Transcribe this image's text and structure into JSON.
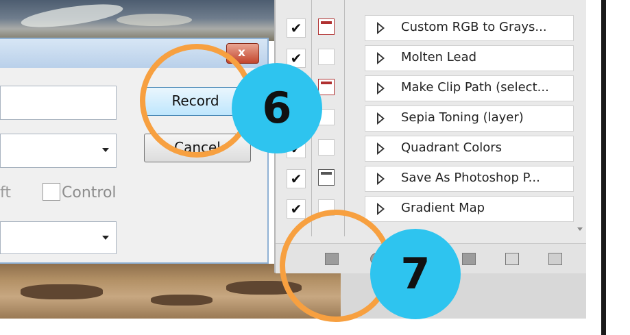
{
  "dialog": {
    "name_value": "",
    "set_value": "",
    "shift_fragment": "ft",
    "control_label": "Control",
    "color_value": "",
    "record_label": "Record",
    "cancel_label": "Cancel",
    "close_glyph": "x"
  },
  "actions_panel": {
    "items": [
      {
        "label": "Custom RGB to Grays...",
        "checked": true,
        "dialog": "on"
      },
      {
        "label": "Molten Lead",
        "checked": true,
        "dialog": "off"
      },
      {
        "label": "Make Clip Path (select...",
        "checked": true,
        "dialog": "on"
      },
      {
        "label": "Sepia Toning (layer)",
        "checked": true,
        "dialog": "off"
      },
      {
        "label": "Quadrant Colors",
        "checked": true,
        "dialog": "off"
      },
      {
        "label": "Save As Photoshop P...",
        "checked": true,
        "dialog": "dark"
      },
      {
        "label": "Gradient Map",
        "checked": true,
        "dialog": "off"
      }
    ],
    "check_glyph": "✔",
    "toolbar_icons": [
      "stop-icon",
      "record-icon",
      "play-icon",
      "folder-icon",
      "new-action-icon",
      "trash-icon"
    ]
  },
  "annotations": {
    "step6": "6",
    "step7": "7"
  },
  "colors": {
    "ring": "#f7a040",
    "badge": "#2ec4ef"
  }
}
